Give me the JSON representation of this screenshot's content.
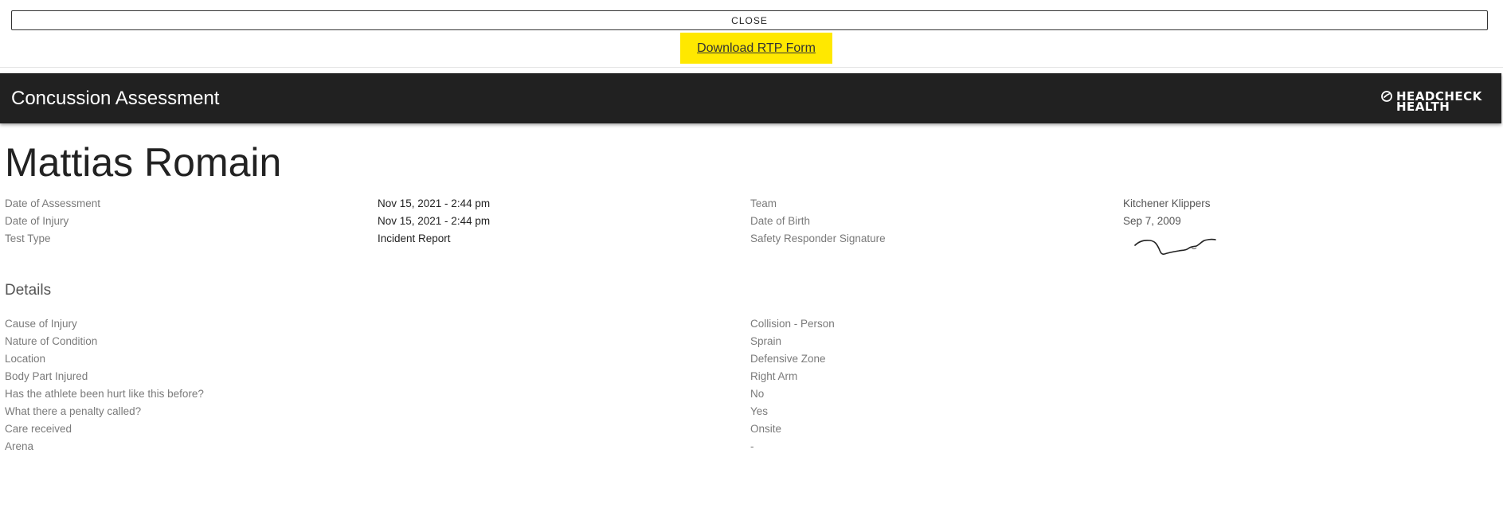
{
  "topbar": {
    "close_label": "CLOSE",
    "rtp_link_label": "Download RTP Form",
    "rtp_highlight_color": "#ffe800"
  },
  "header": {
    "title": "Concussion Assessment",
    "logo_line1": "HEADCHECK",
    "logo_line2": "HEALTH",
    "logo_icon": "gauge-icon",
    "background_color": "#212121"
  },
  "athlete": {
    "name": "Mattias Romain"
  },
  "summary": {
    "left_labels": [
      "Date of Assessment",
      "Date of Injury",
      "Test Type"
    ],
    "left_values": [
      "Nov 15, 2021 - 2:44 pm",
      "Nov 15, 2021 - 2:44 pm",
      "Incident Report"
    ],
    "right_labels": [
      "Team",
      "Date of Birth",
      "Safety Responder Signature"
    ],
    "right_values": [
      "Kitchener Klippers",
      "Sep 7, 2009"
    ]
  },
  "details": {
    "title": "Details",
    "labels": [
      "Cause of Injury",
      "Nature of Condition",
      "Location",
      "Body Part Injured",
      "Has the athlete been hurt like this before?",
      "What there a penalty called?",
      "Care received",
      "Arena"
    ],
    "values": [
      "Collision - Person",
      "Sprain",
      "Defensive Zone",
      "Right Arm",
      "No",
      "Yes",
      "Onsite",
      "-"
    ]
  }
}
